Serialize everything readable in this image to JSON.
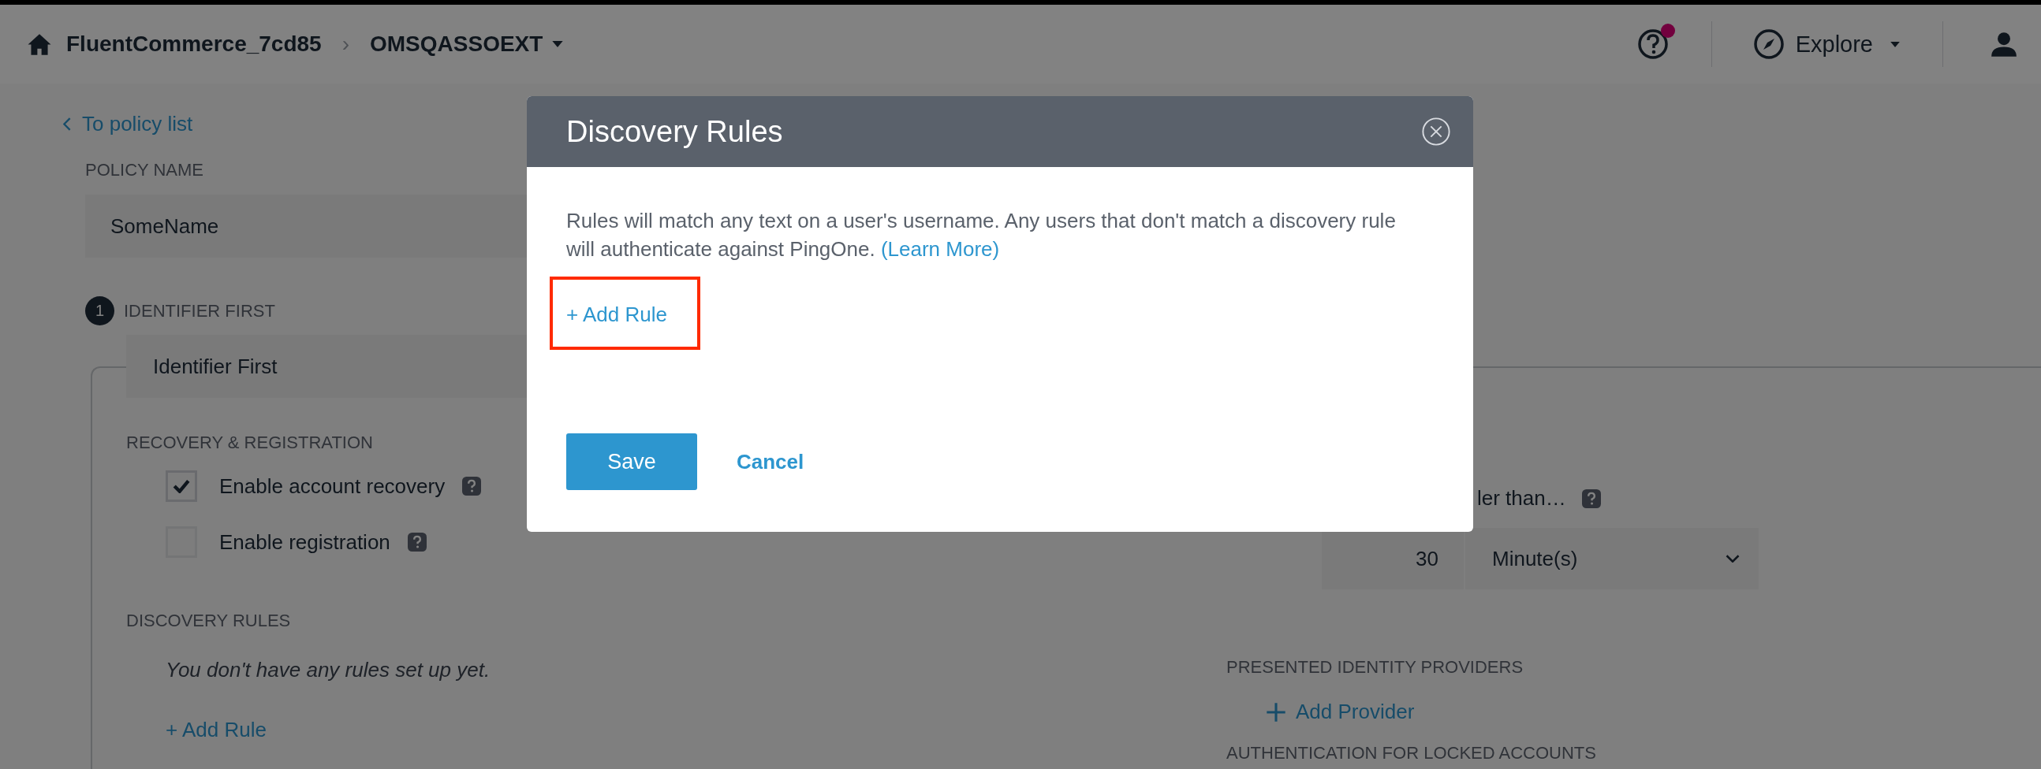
{
  "top_bar": {
    "home_label": "FluentCommerce_7cd85",
    "separator": "›",
    "environment": "OMSQASSOEXT",
    "help_notification": true,
    "explore": "Explore"
  },
  "back_link": "To policy list",
  "policy_name": {
    "label": "POLICY NAME",
    "value": "SomeName"
  },
  "step": {
    "number": "1",
    "title": "IDENTIFIER FIRST",
    "value": "Identifier First"
  },
  "recovery": {
    "title": "RECOVERY & REGISTRATION",
    "options": [
      {
        "label": "Enable account recovery",
        "checked": true
      },
      {
        "label": "Enable registration",
        "checked": false
      }
    ]
  },
  "discovery_rules": {
    "title": "DISCOVERY RULES",
    "empty_text": "You don't have any rules set up yet.",
    "add_label": "+ Add Rule"
  },
  "session": {
    "label": "ler than…",
    "amount": "30",
    "unit": "Minute(s)"
  },
  "providers": {
    "title": "PRESENTED IDENTITY PROVIDERS",
    "add_label": "Add Provider"
  },
  "locked_accounts": {
    "title": "AUTHENTICATION FOR LOCKED ACCOUNTS"
  },
  "modal": {
    "title": "Discovery Rules",
    "description": "Rules will match any text on a user's username. Any users that don't match a discovery rule will authenticate against PingOne.",
    "learn_more": "(Learn More)",
    "add_rule": "+ Add Rule",
    "add_rule_highlighted": true,
    "buttons": [
      {
        "label": "Save",
        "kind": "primary"
      },
      {
        "label": "Cancel",
        "kind": "link"
      }
    ]
  }
}
